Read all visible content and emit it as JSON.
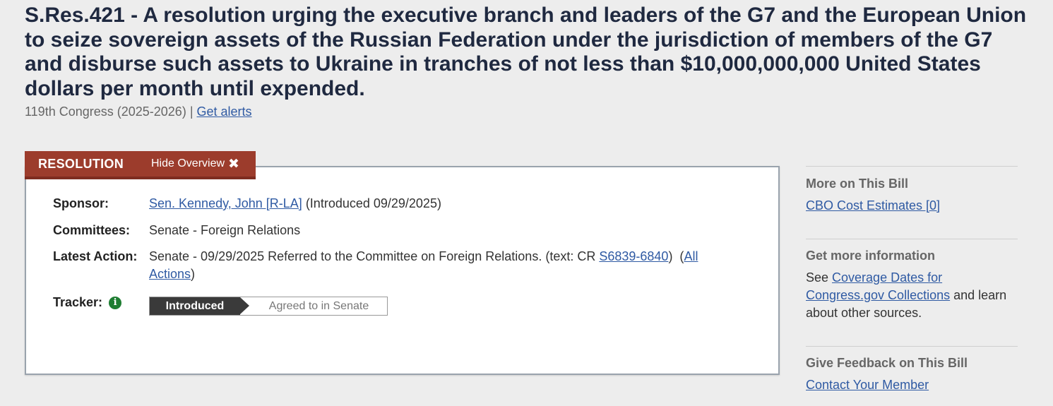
{
  "title": "S.Res.421 - A resolution urging the executive branch and leaders of the G7 and the European Union to seize sovereign assets of the Russian Federation under the jurisdiction of members of the G7 and disburse such assets to Ukraine in tranches of not less than $10,000,000,000 United States dollars per month until expended.",
  "congress": {
    "text": "119th Congress (2025-2026) |",
    "alerts_link": "Get alerts"
  },
  "tab": {
    "type": "RESOLUTION",
    "hide_label": "Hide Overview",
    "close_glyph": "✖"
  },
  "overview": {
    "sponsor_label": "Sponsor:",
    "sponsor_link": "Sen. Kennedy, John [R-LA]",
    "sponsor_suffix": " (Introduced 09/29/2025)",
    "committees_label": "Committees:",
    "committees_value": "Senate - Foreign Relations",
    "latest_label": "Latest Action:",
    "latest_text": "Senate - 09/29/2025 Referred to the Committee on Foreign Relations. (text: CR ",
    "latest_cr_link": "S6839-6840",
    "latest_after": ")  (",
    "all_actions_link": "All Actions",
    "latest_close": ")",
    "tracker_label": "Tracker:",
    "tracker_info_glyph": "i",
    "tracker_steps": [
      "Introduced",
      "Agreed to in Senate"
    ],
    "tracker_current": "Introduced"
  },
  "sidebar": {
    "more_heading": "More on This Bill",
    "cbo_link": "CBO Cost Estimates [0]",
    "info_heading": "Get more information",
    "info_see": "See ",
    "coverage_link": "Coverage Dates for Congress.gov Collections",
    "info_after": " and learn about other sources.",
    "feedback_heading": "Give Feedback on This Bill",
    "contact_link": "Contact Your Member"
  },
  "colors": {
    "tab_bg": "#9c3c2c",
    "link": "#2f5aa3",
    "title": "#1f2940",
    "tracker_active": "#3a3a3a",
    "info_icon": "#1e7d32"
  }
}
